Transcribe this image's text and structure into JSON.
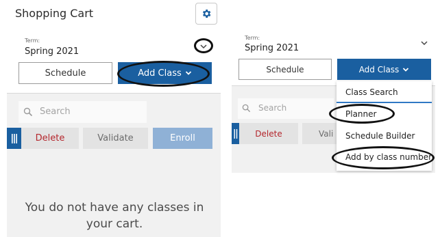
{
  "left_panel": {
    "title": "Shopping Cart",
    "settings_icon": "gear-icon",
    "term": {
      "label": "Term:",
      "value": "Spring 2021"
    },
    "buttons": {
      "schedule": "Schedule",
      "add_class": "Add Class"
    },
    "search": {
      "placeholder": "Search"
    },
    "actions": {
      "delete": "Delete",
      "validate": "Validate",
      "enroll": "Enroll"
    },
    "empty_message": "You do not have any classes in your cart."
  },
  "right_panel": {
    "term": {
      "label": "Term:",
      "value": "Spring 2021"
    },
    "buttons": {
      "schedule": "Schedule",
      "add_class": "Add Class"
    },
    "search": {
      "placeholder": "Search"
    },
    "actions": {
      "delete": "Delete",
      "validate_partial": "Vali"
    },
    "menu": {
      "items": [
        "Class Search",
        "Planner",
        "Schedule Builder",
        "Add by class number"
      ]
    }
  },
  "colors": {
    "primary": "#1a5fa0",
    "enroll_disabled": "#8fb1d6",
    "delete_text": "#b4262c",
    "panel_bg": "#f1f1f1",
    "annotation": "#111111"
  }
}
